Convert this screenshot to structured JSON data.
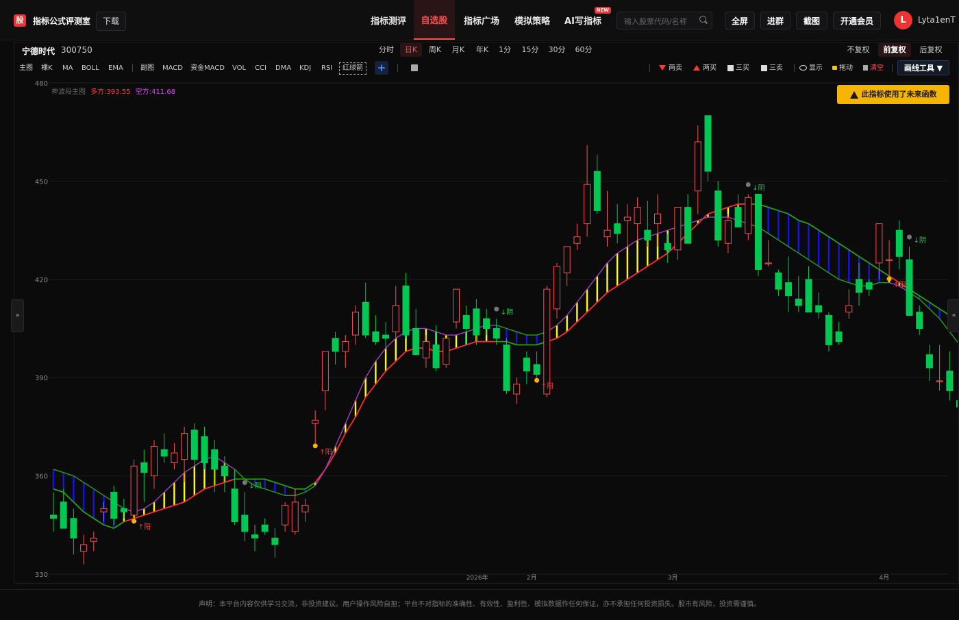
{
  "header": {
    "logo_char": "股",
    "brand": "指标公式评测室",
    "download": "下载",
    "nav": [
      "指标测评",
      "自选股",
      "指标广场",
      "模拟策略",
      "AI写指标"
    ],
    "active_nav": "自选股",
    "new_badge": "NEW",
    "search_placeholder": "输入股票代码/名称",
    "buttons": [
      "全屏",
      "进群",
      "截图",
      "开通会员"
    ],
    "avatar_letter": "L",
    "username": "Lyta1enT"
  },
  "stock": {
    "name": "宁德时代",
    "code": "300750"
  },
  "periods": [
    "分时",
    "日K",
    "周K",
    "月K",
    "年K",
    "1分",
    "15分",
    "30分",
    "60分"
  ],
  "active_period": "日K",
  "adjust": [
    "不复权",
    "前复权",
    "后复权"
  ],
  "active_adjust": "前复权",
  "indicators": [
    "主图",
    "裸K",
    "MA",
    "BOLL",
    "EMA",
    "副图",
    "MACD",
    "资金MACD",
    "VOL",
    "CCI",
    "DMA",
    "KDJ",
    "RSI",
    "红绿箭"
  ],
  "tools": [
    "两卖",
    "两买",
    "三买",
    "三卖",
    "显示",
    "拖动",
    "清空"
  ],
  "draw_tool": "画线工具 ▼",
  "legend": {
    "main": "神波段主图",
    "long": "多方:393.55",
    "short": "空方:411.68"
  },
  "warning": "此指标使用了未来函数",
  "footer": "声明：本平台内容仅供学习交流，非投资建议。用户操作风险自担；平台不对指标的准确性、有效性、盈利性、模拟数据作任何保证，亦不承担任何投资损失。股市有风险，投资需谨慎。",
  "side_left": "»",
  "side_right": "«",
  "colors": {
    "up": "#ff4d4f",
    "down": "#00c853",
    "band_long": "#ffff00",
    "band_short": "#1414e6",
    "warning": "#f5b400"
  },
  "chart_data": {
    "type": "candlestick",
    "ylim": [
      330,
      480
    ],
    "yticks": [
      330,
      360,
      390,
      420,
      450,
      480
    ],
    "date_labels": [
      {
        "index": 41,
        "text": "2026年"
      },
      {
        "index": 47,
        "text": "2月"
      },
      {
        "index": 61,
        "text": "3月"
      },
      {
        "index": 82,
        "text": "4月"
      }
    ],
    "annotations": [
      {
        "index": 8,
        "text": "↑阳",
        "kind": "buy"
      },
      {
        "index": 19,
        "text": "↓阴",
        "kind": "sell"
      },
      {
        "index": 26,
        "text": "↑阳",
        "kind": "buy"
      },
      {
        "index": 44,
        "text": "↓阴",
        "kind": "sell"
      },
      {
        "index": 48,
        "text": "↑阳",
        "kind": "buy"
      },
      {
        "index": 69,
        "text": "↓阴",
        "kind": "sell"
      },
      {
        "index": 83,
        "text": "↑阳",
        "kind": "buy"
      },
      {
        "index": 85,
        "text": "↓阴",
        "kind": "sell"
      }
    ],
    "candles": [
      {
        "o": 348,
        "h": 355,
        "l": 343,
        "c": 347
      },
      {
        "o": 352,
        "h": 356,
        "l": 344,
        "c": 344
      },
      {
        "o": 347,
        "h": 350,
        "l": 336,
        "c": 341
      },
      {
        "o": 337,
        "h": 342,
        "l": 333,
        "c": 339
      },
      {
        "o": 340,
        "h": 343,
        "l": 337,
        "c": 341
      },
      {
        "o": 349,
        "h": 352,
        "l": 346,
        "c": 350
      },
      {
        "o": 355,
        "h": 357,
        "l": 345,
        "c": 347
      },
      {
        "o": 350,
        "h": 353,
        "l": 347,
        "c": 349
      },
      {
        "o": 348,
        "h": 365,
        "l": 347,
        "c": 363
      },
      {
        "o": 364,
        "h": 368,
        "l": 352,
        "c": 361
      },
      {
        "o": 360,
        "h": 371,
        "l": 356,
        "c": 369
      },
      {
        "o": 368,
        "h": 373,
        "l": 364,
        "c": 366
      },
      {
        "o": 364,
        "h": 370,
        "l": 362,
        "c": 367
      },
      {
        "o": 365,
        "h": 375,
        "l": 358,
        "c": 373
      },
      {
        "o": 374,
        "h": 376,
        "l": 363,
        "c": 365
      },
      {
        "o": 372,
        "h": 375,
        "l": 362,
        "c": 364
      },
      {
        "o": 368,
        "h": 371,
        "l": 355,
        "c": 362
      },
      {
        "o": 363,
        "h": 366,
        "l": 355,
        "c": 360
      },
      {
        "o": 356,
        "h": 362,
        "l": 345,
        "c": 346
      },
      {
        "o": 348,
        "h": 355,
        "l": 340,
        "c": 343
      },
      {
        "o": 342,
        "h": 345,
        "l": 337,
        "c": 341
      },
      {
        "o": 345,
        "h": 347,
        "l": 342,
        "c": 343
      },
      {
        "o": 341,
        "h": 344,
        "l": 335,
        "c": 339
      },
      {
        "o": 345,
        "h": 352,
        "l": 343,
        "c": 351
      },
      {
        "o": 343,
        "h": 356,
        "l": 342,
        "c": 352
      },
      {
        "o": 349,
        "h": 353,
        "l": 346,
        "c": 351
      },
      {
        "o": 376,
        "h": 380,
        "l": 370,
        "c": 377
      },
      {
        "o": 386,
        "h": 398,
        "l": 380,
        "c": 398
      },
      {
        "o": 402,
        "h": 404,
        "l": 394,
        "c": 398
      },
      {
        "o": 398,
        "h": 403,
        "l": 393,
        "c": 401
      },
      {
        "o": 403,
        "h": 412,
        "l": 400,
        "c": 410
      },
      {
        "o": 413,
        "h": 419,
        "l": 402,
        "c": 403
      },
      {
        "o": 404,
        "h": 409,
        "l": 400,
        "c": 401
      },
      {
        "o": 403,
        "h": 407,
        "l": 399,
        "c": 402
      },
      {
        "o": 404,
        "h": 418,
        "l": 402,
        "c": 412
      },
      {
        "o": 418,
        "h": 422,
        "l": 402,
        "c": 403
      },
      {
        "o": 405,
        "h": 411,
        "l": 397,
        "c": 397
      },
      {
        "o": 396,
        "h": 403,
        "l": 393,
        "c": 401
      },
      {
        "o": 400,
        "h": 406,
        "l": 392,
        "c": 393
      },
      {
        "o": 394,
        "h": 402,
        "l": 393,
        "c": 402
      },
      {
        "o": 407,
        "h": 417,
        "l": 405,
        "c": 417
      },
      {
        "o": 409,
        "h": 412,
        "l": 400,
        "c": 405
      },
      {
        "o": 411,
        "h": 414,
        "l": 400,
        "c": 403
      },
      {
        "o": 408,
        "h": 411,
        "l": 403,
        "c": 405
      },
      {
        "o": 405,
        "h": 408,
        "l": 400,
        "c": 402
      },
      {
        "o": 400,
        "h": 402,
        "l": 385,
        "c": 386
      },
      {
        "o": 385,
        "h": 390,
        "l": 382,
        "c": 388
      },
      {
        "o": 396,
        "h": 398,
        "l": 388,
        "c": 392
      },
      {
        "o": 394,
        "h": 398,
        "l": 390,
        "c": 391
      },
      {
        "o": 385,
        "h": 418,
        "l": 384,
        "c": 417
      },
      {
        "o": 411,
        "h": 425,
        "l": 408,
        "c": 424
      },
      {
        "o": 422,
        "h": 430,
        "l": 418,
        "c": 430
      },
      {
        "o": 431,
        "h": 437,
        "l": 429,
        "c": 433
      },
      {
        "o": 437,
        "h": 461,
        "l": 433,
        "c": 449
      },
      {
        "o": 453,
        "h": 458,
        "l": 440,
        "c": 441
      },
      {
        "o": 433,
        "h": 447,
        "l": 430,
        "c": 435
      },
      {
        "o": 437,
        "h": 443,
        "l": 431,
        "c": 434
      },
      {
        "o": 438,
        "h": 443,
        "l": 430,
        "c": 439
      },
      {
        "o": 437,
        "h": 445,
        "l": 432,
        "c": 442
      },
      {
        "o": 435,
        "h": 444,
        "l": 430,
        "c": 432
      },
      {
        "o": 437,
        "h": 446,
        "l": 430,
        "c": 440
      },
      {
        "o": 431,
        "h": 434,
        "l": 425,
        "c": 429
      },
      {
        "o": 429,
        "h": 442,
        "l": 426,
        "c": 442
      },
      {
        "o": 442,
        "h": 446,
        "l": 433,
        "c": 431
      },
      {
        "o": 447,
        "h": 467,
        "l": 440,
        "c": 462
      },
      {
        "o": 470,
        "h": 468,
        "l": 450,
        "c": 453
      },
      {
        "o": 447,
        "h": 450,
        "l": 430,
        "c": 432
      },
      {
        "o": 431,
        "h": 440,
        "l": 428,
        "c": 438
      },
      {
        "o": 442,
        "h": 446,
        "l": 436,
        "c": 436
      },
      {
        "o": 434,
        "h": 446,
        "l": 432,
        "c": 445
      },
      {
        "o": 446,
        "h": 446,
        "l": 421,
        "c": 423
      },
      {
        "o": 425,
        "h": 432,
        "l": 424,
        "c": 425
      },
      {
        "o": 422,
        "h": 423,
        "l": 415,
        "c": 417
      },
      {
        "o": 419,
        "h": 427,
        "l": 410,
        "c": 415
      },
      {
        "o": 414,
        "h": 421,
        "l": 410,
        "c": 412
      },
      {
        "o": 420,
        "h": 424,
        "l": 410,
        "c": 410
      },
      {
        "o": 412,
        "h": 416,
        "l": 408,
        "c": 410
      },
      {
        "o": 409,
        "h": 410,
        "l": 398,
        "c": 400
      },
      {
        "o": 404,
        "h": 407,
        "l": 400,
        "c": 401
      },
      {
        "o": 410,
        "h": 417,
        "l": 408,
        "c": 412
      },
      {
        "o": 420,
        "h": 425,
        "l": 412,
        "c": 416
      },
      {
        "o": 419,
        "h": 420,
        "l": 415,
        "c": 417
      },
      {
        "o": 425,
        "h": 437,
        "l": 420,
        "c": 437
      },
      {
        "o": 426,
        "h": 432,
        "l": 421,
        "c": 426
      },
      {
        "o": 435,
        "h": 438,
        "l": 423,
        "c": 427
      },
      {
        "o": 426,
        "h": 430,
        "l": 409,
        "c": 409
      },
      {
        "o": 410,
        "h": 412,
        "l": 403,
        "c": 405
      },
      {
        "o": 397,
        "h": 400,
        "l": 389,
        "c": 393
      },
      {
        "o": 389,
        "h": 400,
        "l": 386,
        "c": 389
      },
      {
        "o": 392,
        "h": 398,
        "l": 383,
        "c": 386
      },
      {
        "o": 383,
        "h": 389,
        "l": 377,
        "c": 381
      }
    ],
    "band_long": [
      356,
      355,
      352,
      349,
      347,
      345,
      344,
      346,
      347,
      348,
      349,
      350,
      351,
      352,
      354,
      356,
      357,
      358,
      359,
      359,
      359,
      359,
      358,
      357,
      356,
      356,
      358,
      362,
      367,
      373,
      378,
      384,
      388,
      392,
      395,
      398,
      399,
      399,
      398,
      398,
      399,
      400,
      401,
      401,
      401,
      401,
      400,
      400,
      400,
      401,
      402,
      404,
      407,
      410,
      413,
      416,
      418,
      420,
      422,
      424,
      426,
      428,
      431,
      434,
      437,
      440,
      441,
      442,
      443,
      443,
      443,
      442,
      441,
      440,
      438,
      437,
      435,
      433,
      431,
      429,
      427,
      425,
      423,
      421,
      419,
      417,
      415,
      413,
      411,
      409,
      407
    ],
    "band_short": [
      362,
      361,
      360,
      358,
      356,
      354,
      352,
      350,
      349,
      350,
      352,
      355,
      358,
      361,
      363,
      365,
      366,
      364,
      362,
      359,
      357,
      356,
      355,
      354,
      354,
      355,
      357,
      362,
      369,
      376,
      383,
      390,
      395,
      399,
      402,
      404,
      405,
      405,
      404,
      403,
      403,
      404,
      405,
      406,
      406,
      405,
      404,
      403,
      403,
      404,
      406,
      409,
      413,
      417,
      421,
      425,
      428,
      430,
      432,
      433,
      434,
      435,
      436,
      437,
      438,
      439,
      439,
      439,
      438,
      437,
      436,
      434,
      432,
      430,
      428,
      426,
      424,
      422,
      420,
      419,
      418,
      418,
      419,
      419,
      418,
      416,
      414,
      411,
      408,
      404,
      400
    ],
    "band_side": [
      1,
      1,
      1,
      1,
      1,
      1,
      1,
      0,
      0,
      0,
      0,
      0,
      0,
      0,
      0,
      0,
      0,
      0,
      1,
      1,
      1,
      1,
      1,
      1,
      1,
      1,
      0,
      0,
      0,
      0,
      0,
      0,
      0,
      0,
      0,
      0,
      0,
      0,
      0,
      0,
      0,
      0,
      0,
      0,
      1,
      1,
      1,
      1,
      1,
      0,
      0,
      0,
      0,
      0,
      0,
      0,
      0,
      0,
      0,
      0,
      0,
      0,
      0,
      0,
      0,
      0,
      0,
      0,
      0,
      1,
      1,
      1,
      1,
      1,
      1,
      1,
      1,
      1,
      1,
      1,
      1,
      1,
      1,
      0,
      0,
      1,
      1,
      1,
      1,
      1,
      1
    ]
  }
}
